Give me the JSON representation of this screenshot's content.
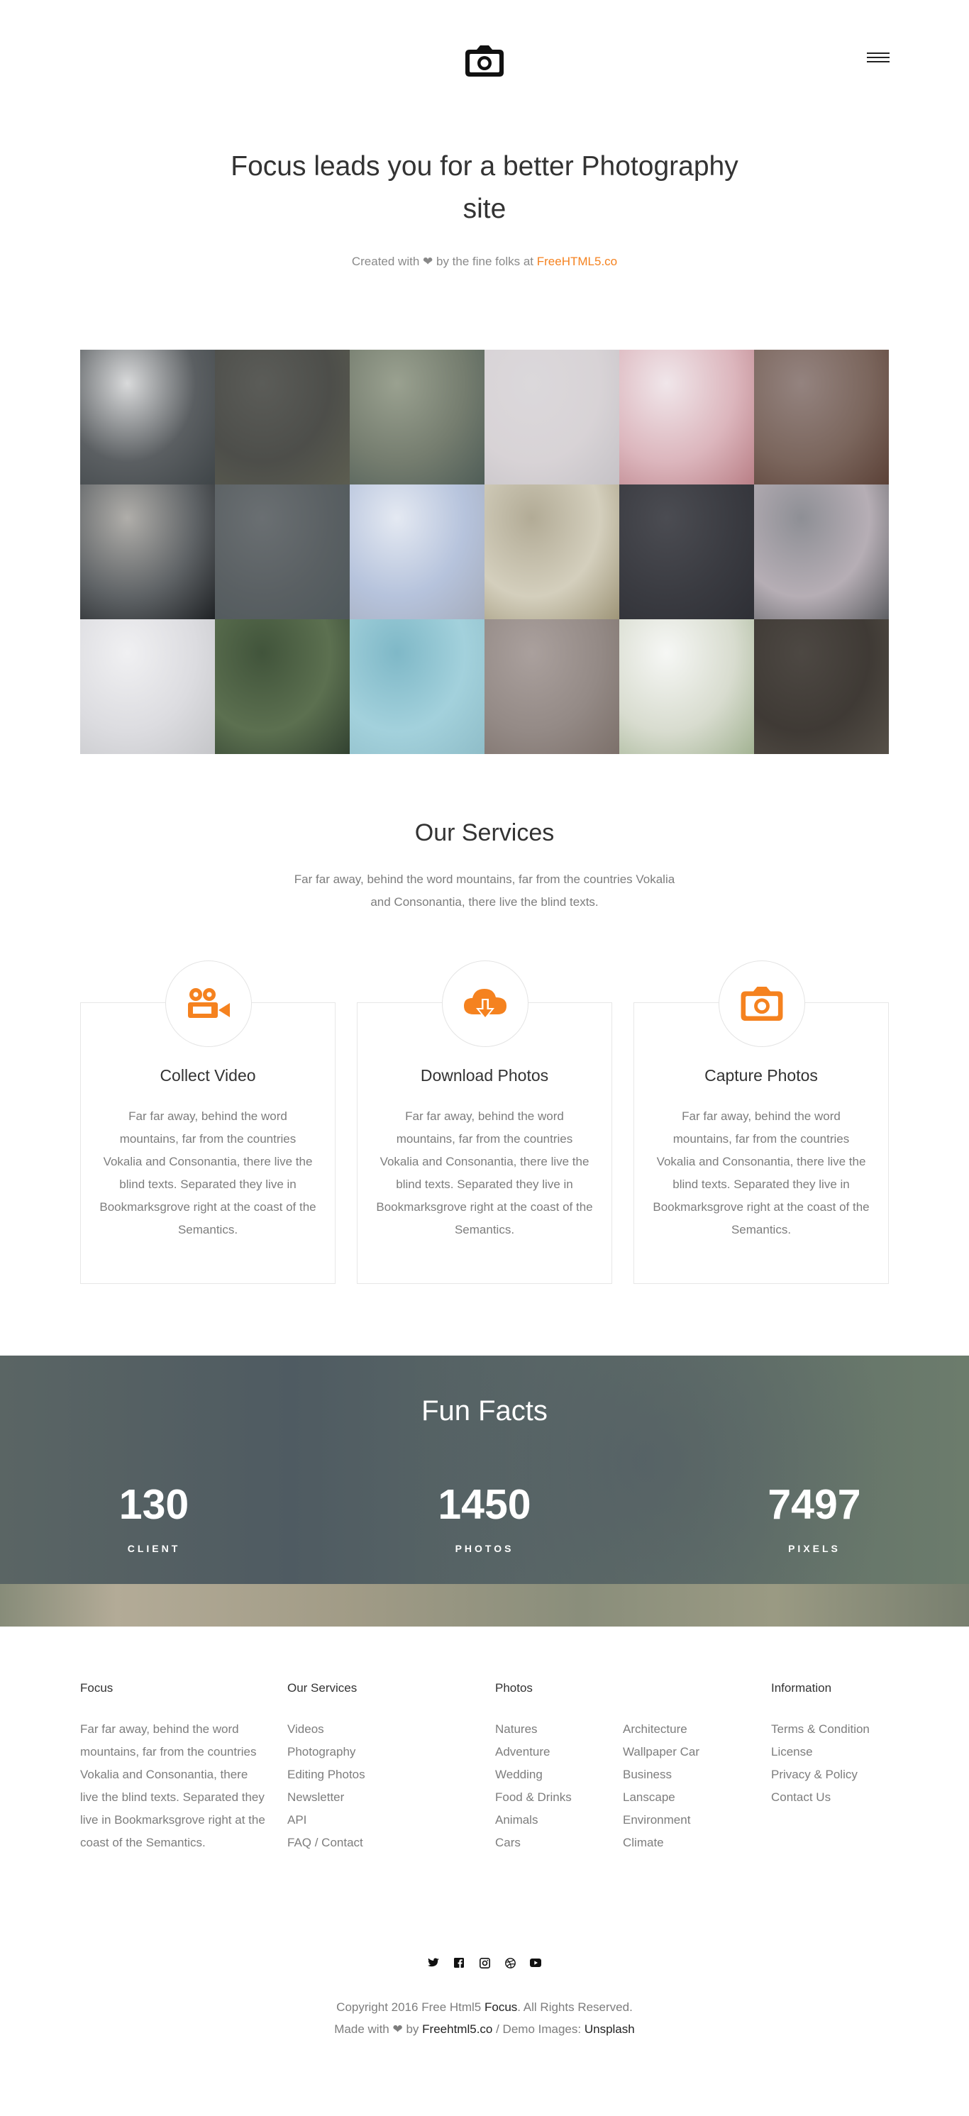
{
  "header": {
    "logo_icon": "camera-icon",
    "menu_icon": "hamburger-icon"
  },
  "hero": {
    "title": "Focus leads you for a better Photography site",
    "credit_prefix": "Created with",
    "credit_middle": "by the fine folks at",
    "credit_link": "FreeHTML5.co",
    "heart_icon": "heart-icon"
  },
  "gallery": {
    "tiles": [
      {
        "c1": "#d9dadb",
        "c2": "#5b5f62",
        "c3": "#3f4548"
      },
      {
        "c1": "#5b5c58",
        "c2": "#4d4e4a",
        "c3": "#5c5d50"
      },
      {
        "c1": "#9aa190",
        "c2": "#757d6f",
        "c3": "#4f5d57"
      },
      {
        "c1": "#dbd8db",
        "c2": "#d8d3d6",
        "c3": "#c5c2c6"
      },
      {
        "c1": "#f0e6ea",
        "c2": "#dcb6bd",
        "c3": "#b97f86"
      },
      {
        "c1": "#94837f",
        "c2": "#7b665d",
        "c3": "#5b4137"
      },
      {
        "c1": "#b0aeaa",
        "c2": "#5f6366",
        "c3": "#1f2225"
      },
      {
        "c1": "#6a6f72",
        "c2": "#5a6063",
        "c3": "#4f585b"
      },
      {
        "c1": "#e4e9f2",
        "c2": "#b6c3dc",
        "c3": "#a5acbc"
      },
      {
        "c1": "#b2ab96",
        "c2": "#d4cfbd",
        "c3": "#9e9578"
      },
      {
        "c1": "#4b4c52",
        "c2": "#3a3b41",
        "c3": "#2e2f35"
      },
      {
        "c1": "#8e8f95",
        "c2": "#b6aeb5",
        "c3": "#5e5f63"
      },
      {
        "c1": "#f0f0f2",
        "c2": "#dcdce0",
        "c3": "#c5c6c9"
      },
      {
        "c1": "#41543b",
        "c2": "#5c7050",
        "c3": "#324231"
      },
      {
        "c1": "#7fb8c7",
        "c2": "#a3d1dc",
        "c3": "#8fbdc8"
      },
      {
        "c1": "#aaa09d",
        "c2": "#948a86",
        "c3": "#7c706a"
      },
      {
        "c1": "#f6f7f5",
        "c2": "#d8dccf",
        "c3": "#a3b393"
      },
      {
        "c1": "#4d4843",
        "c2": "#3f3a35",
        "c3": "#565048"
      }
    ]
  },
  "services": {
    "title": "Our Services",
    "intro": "Far far away, behind the word mountains, far from the countries Vokalia and Consonantia, there live the blind texts.",
    "accent": "#f5821f",
    "items": [
      {
        "icon": "video-camera-icon",
        "title": "Collect Video",
        "text": "Far far away, behind the word mountains, far from the countries Vokalia and Consonantia, there live the blind texts. Separated they live in Bookmarksgrove right at the coast of the Semantics."
      },
      {
        "icon": "cloud-download-icon",
        "title": "Download Photos",
        "text": "Far far away, behind the word mountains, far from the countries Vokalia and Consonantia, there live the blind texts. Separated they live in Bookmarksgrove right at the coast of the Semantics."
      },
      {
        "icon": "camera-icon",
        "title": "Capture Photos",
        "text": "Far far away, behind the word mountains, far from the countries Vokalia and Consonantia, there live the blind texts. Separated they live in Bookmarksgrove right at the coast of the Semantics."
      }
    ]
  },
  "facts": {
    "title": "Fun Facts",
    "items": [
      {
        "number": "130",
        "label": "CLIENT"
      },
      {
        "number": "1450",
        "label": "PHOTOS"
      },
      {
        "number": "7497",
        "label": "PIXELS"
      }
    ]
  },
  "footer": {
    "about": {
      "title": "Focus",
      "text": "Far far away, behind the word mountains, far from the countries Vokalia and Consonantia, there live the blind texts. Separated they live in Bookmarksgrove right at the coast of the Semantics."
    },
    "services": {
      "title": "Our Services",
      "links": [
        "Videos",
        "Photography",
        "Editing Photos",
        "Newsletter",
        "API",
        "FAQ / Contact"
      ]
    },
    "photos": {
      "title": "Photos",
      "links_left": [
        "Natures",
        "Adventure",
        "Wedding",
        "Food & Drinks",
        "Animals",
        "Cars"
      ],
      "links_right": [
        "Architecture",
        "Wallpaper Car",
        "Business",
        "Lanscape",
        "Environment",
        "Climate"
      ]
    },
    "information": {
      "title": "Information",
      "links": [
        "Terms & Condition",
        "License",
        "Privacy & Policy",
        "Contact Us"
      ]
    },
    "social": [
      "twitter-icon",
      "facebook-icon",
      "instagram-icon",
      "dribbble-icon",
      "youtube-icon"
    ],
    "copyright_prefix": "Copyright 2016 Free Html5",
    "copyright_brand": "Focus",
    "copyright_suffix": ". All Rights Reserved.",
    "made_prefix": "Made with",
    "made_by": "by",
    "made_link": "Freehtml5.co",
    "demo_prefix": "/ Demo Images:",
    "demo_link": "Unsplash"
  }
}
